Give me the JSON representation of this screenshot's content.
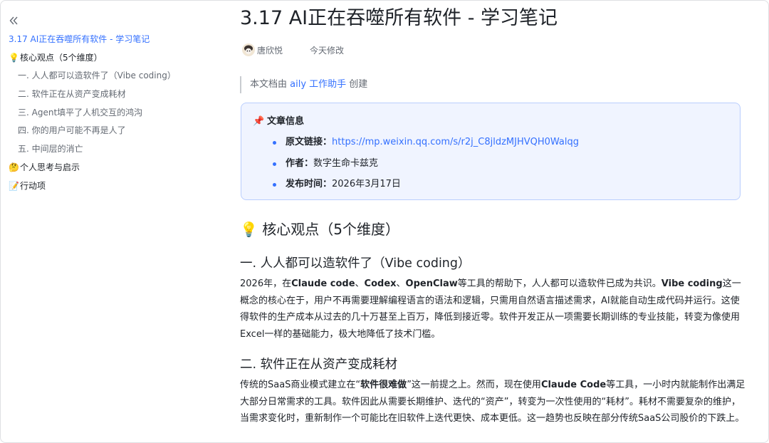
{
  "sidebar": {
    "collapse_icon": "double-chevron-left-icon",
    "toc": [
      {
        "label": "3.17 AI正在吞噬所有软件 - 学习笔记",
        "level": 1,
        "active": true,
        "emoji": ""
      },
      {
        "label": "核心观点（5个维度）",
        "level": 1,
        "emoji": "💡"
      },
      {
        "label": "一. 人人都可以造软件了（Vibe coding）",
        "level": 2,
        "emoji": ""
      },
      {
        "label": "二. 软件正在从资产变成耗材",
        "level": 2,
        "emoji": ""
      },
      {
        "label": "三. Agent填平了人机交互的鸿沟",
        "level": 2,
        "emoji": ""
      },
      {
        "label": "四. 你的用户可能不再是人了",
        "level": 2,
        "emoji": ""
      },
      {
        "label": "五. 中间层的消亡",
        "level": 2,
        "emoji": ""
      },
      {
        "label": "个人思考与启示",
        "level": 1,
        "emoji": "🤔"
      },
      {
        "label": "行动项",
        "level": 1,
        "emoji": "📝"
      }
    ]
  },
  "doc": {
    "title": "3.17 AI正在吞噬所有软件 - 学习笔记",
    "author": "唐欣悦",
    "modified": "今天修改",
    "quote": {
      "prefix": "本文档由 ",
      "link": "aily 工作助手",
      "suffix": " 创建"
    },
    "callout": {
      "icon": "pushpin-icon",
      "title": "文章信息",
      "items": [
        {
          "key": "原文链接：",
          "value": "https://mp.weixin.qq.com/s/r2j_C8jldzMJHVQH0Walqg",
          "is_link": true
        },
        {
          "key": "作者：",
          "value": "数字生命卡兹克",
          "is_link": false
        },
        {
          "key": "发布时间：",
          "value": "2026年3月17日",
          "is_link": false
        }
      ]
    },
    "section_title": "💡 核心观点（5个维度）",
    "h3_1": "一. 人人都可以造软件了（Vibe coding）",
    "p1": [
      {
        "t": "2026年，在"
      },
      {
        "t": "Claude code",
        "b": true
      },
      {
        "t": "、"
      },
      {
        "t": "Codex",
        "b": true
      },
      {
        "t": "、"
      },
      {
        "t": "OpenClaw",
        "b": true
      },
      {
        "t": "等工具的帮助下，人人都可以造软件已成为共识。"
      },
      {
        "t": "Vibe coding",
        "b": true
      },
      {
        "t": "这一概念的核心在于，用户不再需要理解编程语言的语法和逻辑，只需用自然语言描述需求，AI就能自动生成代码并运行。这使得软件的生产成本从过去的几十万甚至上百万，降低到接近零。软件开发正从一项需要长期训练的专业技能，转变为像使用Excel一样的基础能力，极大地降低了技术门槛。"
      }
    ],
    "h3_2": "二. 软件正在从资产变成耗材",
    "p2": [
      {
        "t": "传统的SaaS商业模式建立在“"
      },
      {
        "t": "软件很难做",
        "b": true
      },
      {
        "t": "”这一前提之上。然而，现在使用"
      },
      {
        "t": "Claude Code",
        "b": true
      },
      {
        "t": "等工具，一小时内就能制作出满足大部分日常需求的工具。软件因此从需要长期维护、迭代的“资产”，转变为一次性使用的“耗材”。耗材不需要复杂的维护，当需求变化时，重新制作一个可能比在旧软件上迭代更快、成本更低。这一趋势也反映在部分传统SaaS公司股价的下跌上。"
      }
    ]
  },
  "colors": {
    "accent": "#3370ff",
    "callout_bg": "#f0f4ff",
    "callout_border": "#bacefd"
  }
}
